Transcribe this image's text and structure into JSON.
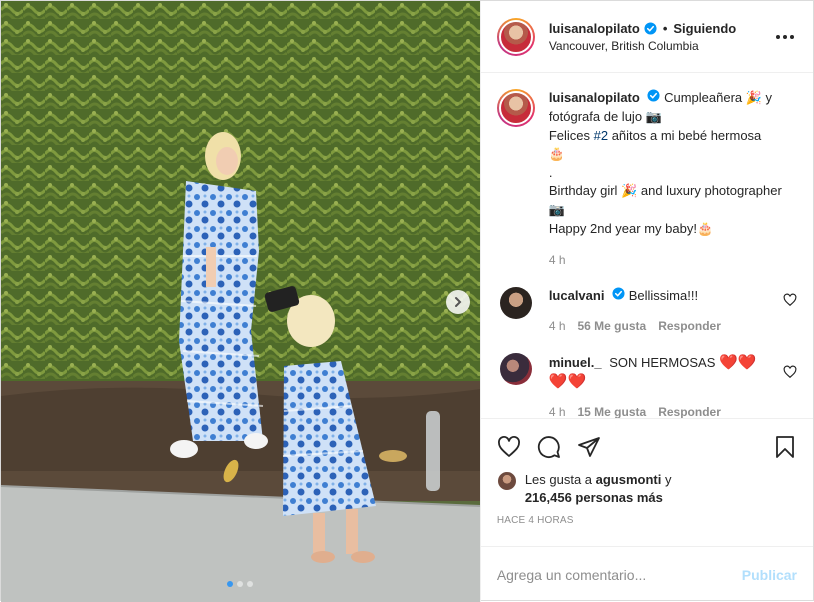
{
  "colors": {
    "link": "#00376b",
    "verified": "#0095f6",
    "muted": "#8e8e8e",
    "heart_red": "#e0245e",
    "post_button_disabled": "#b2dffc",
    "carousel_active_dot": "#3797f0"
  },
  "post": {
    "carousel": {
      "current_slide": 1,
      "total_slides": 3
    }
  },
  "header": {
    "username": "luisanalopilato",
    "separator": "•",
    "follow_status": "Siguiendo",
    "location": "Vancouver, British Columbia",
    "more_icon": "more-options-icon"
  },
  "caption": {
    "username": "luisanalopilato",
    "text_1": "Cumpleañera",
    "emoji_party": "🎉",
    "text_2": " y fotógrafa de lujo",
    "emoji_camera": "📷",
    "text_3": "Felices ",
    "hashtag": "#2",
    "text_4": " añitos a mi bebé hermosa",
    "emoji_cake": "🎂",
    "dot": ".",
    "text_5": "Birthday girl",
    "text_6": " and luxury photographer",
    "text_7": "Happy 2nd year my baby!",
    "time": "4 h"
  },
  "comments": [
    {
      "username": "lucalvani",
      "text": "Bellissima!!!",
      "time": "4 h",
      "likes": "56 Me gusta",
      "reply": "Responder"
    },
    {
      "username": "minuel._",
      "text": "SON HERMOSAS",
      "hearts_inline": "❤️❤️",
      "hearts_next": "❤️❤️",
      "time": "4 h",
      "likes": "15 Me gusta",
      "reply": "Responder"
    }
  ],
  "actions": {
    "icons": [
      "heart-icon",
      "comment-icon",
      "share-icon",
      "bookmark-icon"
    ]
  },
  "likes": {
    "prefix": "Les gusta a ",
    "user": "agusmonti",
    "middle": " y",
    "count": "216,456 personas más"
  },
  "timestamp": "HACE 4 HORAS",
  "add_comment": {
    "placeholder": "Agrega un comentario...",
    "post_label": "Publicar"
  }
}
